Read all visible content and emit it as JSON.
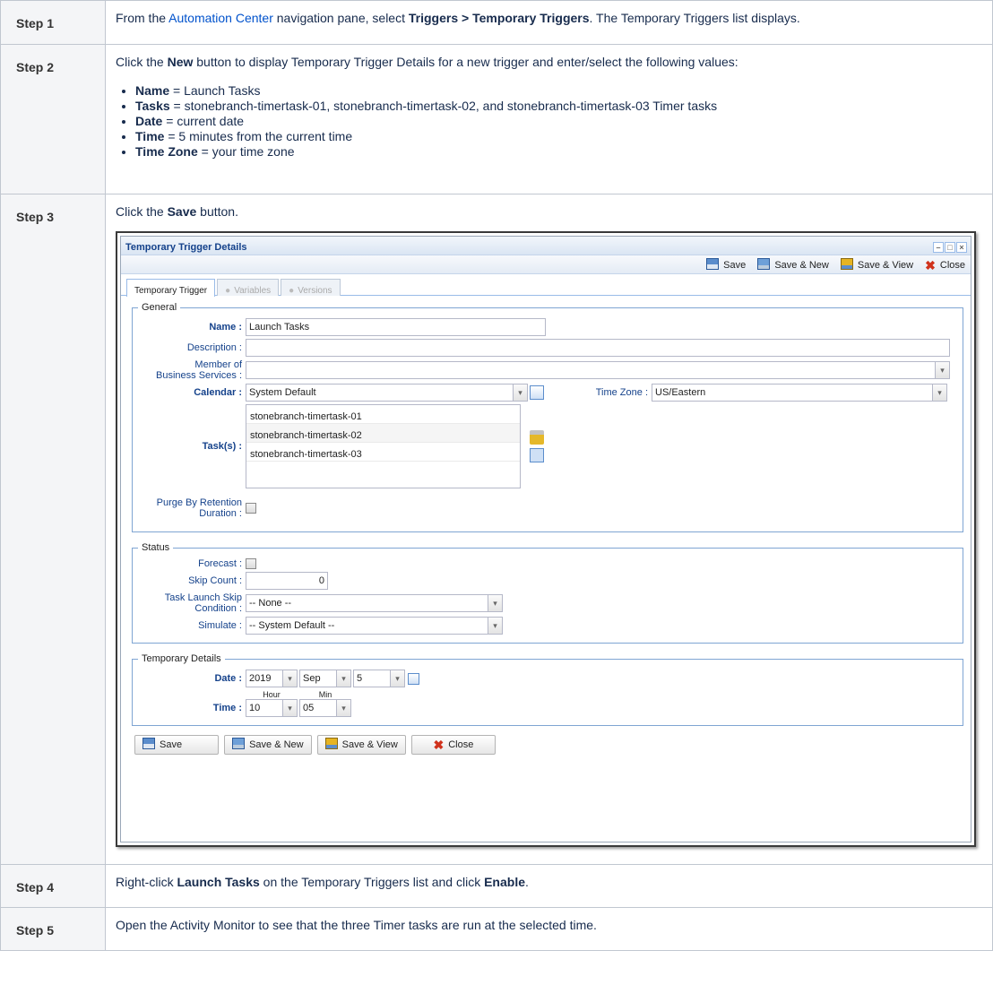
{
  "steps": [
    {
      "name": "Step 1",
      "pre": "From the ",
      "link": "Automation Center",
      "mid": " navigation pane, select ",
      "bold": "Triggers > Temporary Triggers",
      "post": ". The Temporary Triggers list displays."
    },
    {
      "name": "Step 2",
      "intro_pre": "Click the ",
      "intro_bold": "New",
      "intro_post": " button to display Temporary Trigger Details for a new trigger and enter/select the following values:",
      "bullets": [
        {
          "key": "Name",
          "val": " = Launch Tasks"
        },
        {
          "key": "Tasks",
          "val": " = stonebranch-timertask-01, stonebranch-timertask-02, and stonebranch-timertask-03 Timer tasks"
        },
        {
          "key": "Date",
          "val": " = current date"
        },
        {
          "key": "Time",
          "val": " = 5 minutes from the current time"
        },
        {
          "key": "Time Zone",
          "val": " = your time zone"
        }
      ]
    },
    {
      "name": "Step 3",
      "pre": "Click the ",
      "bold": "Save",
      "post": " button."
    },
    {
      "name": "Step 4",
      "pre": "Right-click ",
      "bold": "Launch Tasks",
      "mid": " on the Temporary Triggers list and click ",
      "bold2": "Enable",
      "post": "."
    },
    {
      "name": "Step 5",
      "text": "Open the Activity Monitor to see that the three Timer tasks are run at the selected time."
    }
  ],
  "dialog": {
    "title": "Temporary Trigger Details",
    "toolbar": {
      "save": "Save",
      "save_new": "Save & New",
      "save_view": "Save & View",
      "close": "Close"
    },
    "tabs": [
      "Temporary Trigger",
      "Variables",
      "Versions"
    ],
    "general": {
      "legend": "General",
      "name_label": "Name :",
      "name_value": "Launch Tasks",
      "description_label": "Description :",
      "description_value": "",
      "member_label1": "Member of",
      "member_label2": "Business Services :",
      "member_value": "",
      "calendar_label": "Calendar :",
      "calendar_value": "System Default",
      "timezone_label": "Time Zone :",
      "timezone_value": "US/Eastern",
      "tasks_label": "Task(s) :",
      "tasks": [
        "stonebranch-timertask-01",
        "stonebranch-timertask-02",
        "stonebranch-timertask-03"
      ],
      "purge_label1": "Purge By Retention",
      "purge_label2": "Duration :"
    },
    "status": {
      "legend": "Status",
      "forecast_label": "Forecast :",
      "skip_label": "Skip Count :",
      "skip_value": "0",
      "launch_skip_label1": "Task Launch Skip",
      "launch_skip_label2": "Condition :",
      "launch_skip_value": "-- None --",
      "simulate_label": "Simulate :",
      "simulate_value": "-- System Default --"
    },
    "temporary": {
      "legend": "Temporary Details",
      "date_label": "Date :",
      "year": "2019",
      "month": "Sep",
      "day": "5",
      "time_label": "Time :",
      "hour_label": "Hour",
      "min_label": "Min",
      "hour": "10",
      "min": "05"
    },
    "buttons": {
      "save": "Save",
      "save_new": "Save & New",
      "save_view": "Save & View",
      "close": "Close"
    }
  }
}
